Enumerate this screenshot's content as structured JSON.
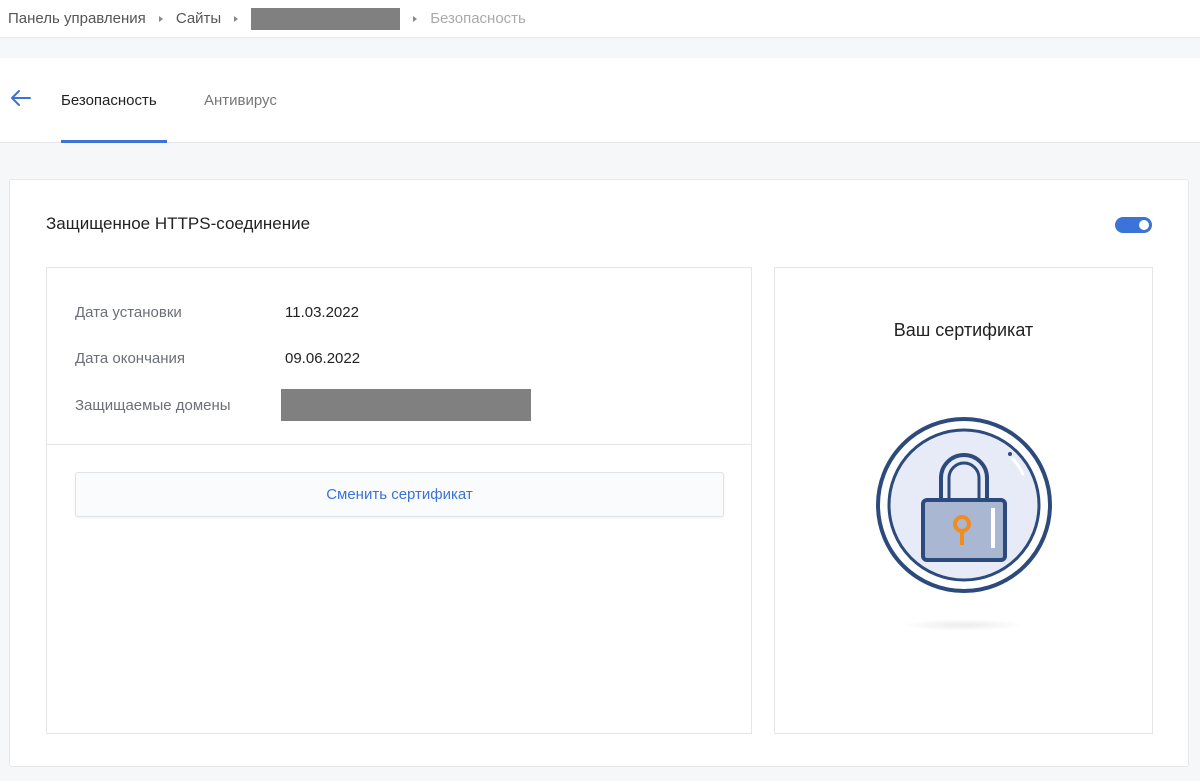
{
  "breadcrumb": {
    "items": [
      "Панель управления",
      "Сайты",
      "Безопасность"
    ]
  },
  "tabs": [
    {
      "label": "Безопасность",
      "active": true
    },
    {
      "label": "Антивирус",
      "active": false
    }
  ],
  "https": {
    "title": "Защищенное HTTPS-соединение",
    "enabled": true
  },
  "certificate": {
    "install_label": "Дата установки",
    "install_value": "11.03.2022",
    "expiry_label": "Дата окончания",
    "expiry_value": "09.06.2022",
    "domains_label": "Защищаемые домены",
    "change_button": "Сменить сертификат",
    "panel_title": "Ваш сертификат"
  },
  "colors": {
    "accent": "#3b73d8",
    "icon_outline": "#2c4a7c",
    "icon_key": "#f28c1e",
    "icon_fill": "#e6ebf7"
  },
  "icons": [
    "back-arrow-icon",
    "chevron-right-icon",
    "lock-certificate-icon"
  ]
}
